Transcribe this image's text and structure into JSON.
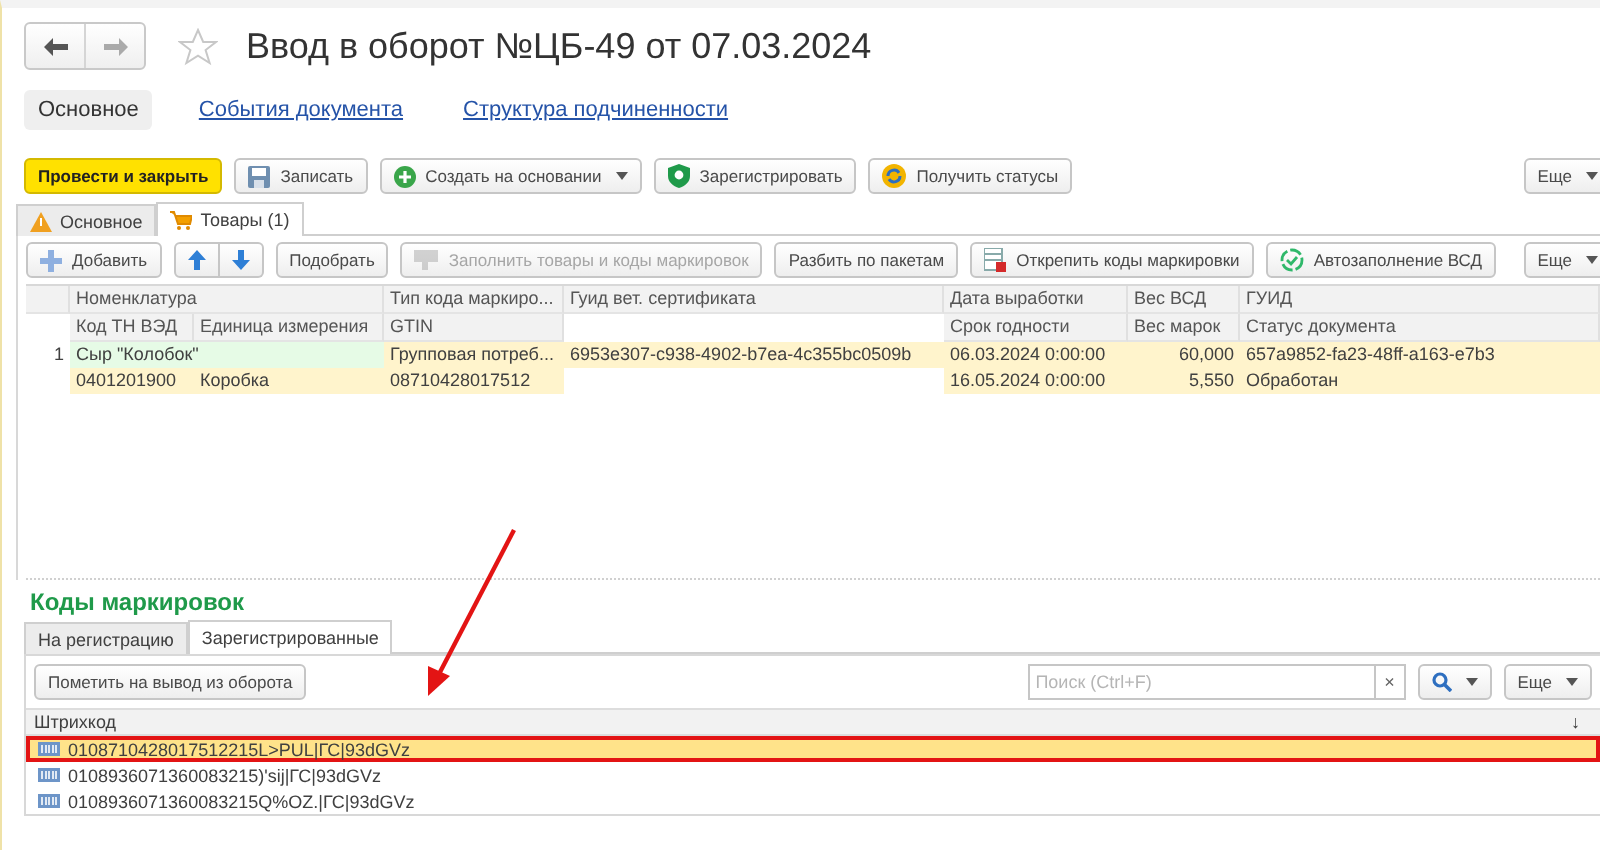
{
  "window": {
    "title": "Ввод в оборот №ЦБ-49 от 07.03.2024"
  },
  "sections": [
    {
      "label": "Основное",
      "selected": true
    },
    {
      "label": "События документа",
      "selected": false
    },
    {
      "label": "Структура подчиненности",
      "selected": false
    }
  ],
  "command_bar": [
    {
      "label": "Провести и закрыть",
      "kind": "primary"
    },
    {
      "label": "Записать",
      "kind": "save"
    },
    {
      "label": "Создать на основании",
      "kind": "create"
    },
    {
      "label": "Зарегистрировать",
      "kind": "register"
    },
    {
      "label": "Получить статусы",
      "kind": "status"
    }
  ],
  "command_more": "Еще",
  "tabs": [
    {
      "label": "Основное",
      "kind": "warning",
      "selected": false
    },
    {
      "label": "Товары (1)",
      "kind": "cart",
      "selected": true
    }
  ],
  "goods_toolbar": [
    {
      "label": "Добавить",
      "kind": "add",
      "disabled": false
    },
    {
      "kind": "up",
      "disabled": false
    },
    {
      "kind": "down",
      "disabled": false
    },
    {
      "label": "Подобрать",
      "kind": "plain",
      "disabled": false
    },
    {
      "label": "Заполнить товары и коды маркировок",
      "kind": "fill",
      "disabled": true
    },
    {
      "label": "Разбить по пакетам",
      "kind": "plain",
      "disabled": false
    },
    {
      "label": "Открепить коды маркировки",
      "kind": "detach",
      "disabled": false
    },
    {
      "label": "Автозаполнение ВСД",
      "kind": "auto",
      "disabled": false
    }
  ],
  "goods_more": "Еще",
  "goods_table": {
    "columns": {
      "nomenclature": "Номенклатура",
      "code_type": "Тип кода маркиро...",
      "vet_certificate": "Гуид вет. сертификата",
      "production_date": "Дата выработки",
      "vsd_weight": "Вес ВСД",
      "guid": "ГУИД",
      "tn_ved": "Код ТН ВЭД",
      "unit": "Единица измерения",
      "gtin": "GTIN",
      "expiry": "Срок годности",
      "mark_weight": "Вес марок",
      "status": "Статус документа"
    },
    "rows": [
      {
        "number": "1",
        "nomenclature": "Сыр \"Колобок\"",
        "code_type": "Групповая потреб...",
        "vet_certificate": "6953e307-c938-4902-b7ea-4c355bc0509b",
        "production_date": "06.03.2024 0:00:00",
        "vsd_weight": "60,000",
        "guid": "657a9852-fa23-48ff-a163-e7b3",
        "tn_ved": "0401201900",
        "unit": "Коробка",
        "gtin": "08710428017512",
        "expiry": "16.05.2024 0:00:00",
        "mark_weight": "5,550",
        "status": "Обработан"
      }
    ]
  },
  "marking": {
    "title": "Коды маркировок",
    "tabs": [
      {
        "label": "На регистрацию",
        "selected": false
      },
      {
        "label": "Зарегистрированные",
        "selected": true
      }
    ],
    "mark_button": "Пометить на вывод из оборота",
    "search": {
      "placeholder": "Поиск (Ctrl+F)"
    },
    "clear": "×",
    "more": "Еще",
    "column": "Штрихкод",
    "sort_mark": "↓",
    "rows": [
      {
        "barcode": "0108710428017512215L>PUL|ГС|93dGVz",
        "selected": true,
        "highlighted": true
      },
      {
        "barcode": "0108936071360083215)'sij|ГС|93dGVz",
        "selected": false,
        "highlighted": false
      },
      {
        "barcode": "0108936071360083215Q%OZ.|ГС|93dGVz",
        "selected": false,
        "highlighted": false
      }
    ]
  },
  "annotation": {
    "arrow": true
  }
}
